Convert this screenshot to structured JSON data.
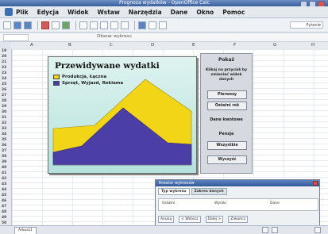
{
  "window": {
    "title": "Prognoza wydatków - OpenOffice Calc"
  },
  "menu": [
    "Plik",
    "Edycja",
    "Widok",
    "Wstaw",
    "Format",
    "Narzędzia",
    "Dane",
    "Okno",
    "Pomoc"
  ],
  "toolbar": {
    "help_text": "Pytanie"
  },
  "formula_bar": {
    "label": "Obszar wykresu"
  },
  "columns": [
    "A",
    "B",
    "C",
    "D",
    "E",
    "F",
    "G",
    "H"
  ],
  "rows": [
    "19",
    "20",
    "21",
    "22",
    "23",
    "24",
    "25",
    "26",
    "27",
    "28",
    "29",
    "30",
    "31",
    "32",
    "33",
    "34",
    "35",
    "36",
    "37",
    "38",
    "39",
    "40",
    "41",
    "42",
    "43",
    "44",
    "45",
    "46",
    "47",
    "48",
    "49",
    "50"
  ],
  "chart": {
    "title": "Przewidywane wydatki",
    "legend": [
      {
        "label": "Produkcja, Łączna",
        "color": "#f2d516"
      },
      {
        "label": "Sprzęt, Wyjazd, Reklama",
        "color": "#4b3ea6"
      }
    ],
    "colors": {
      "series_yellow": "#f2d516",
      "series_purple": "#4b3ea6"
    }
  },
  "panel": {
    "title": "Pokaż",
    "description": "Klikaj na przycisk by zmieniać widok danych",
    "buttons": [
      "Pierwszy",
      "Ostatni rok",
      "Wszystkie"
    ],
    "sections": [
      "Dane kwotowe",
      "Pensje"
    ],
    "footer": "Wyczyść"
  },
  "dialog": {
    "title": "Kreator wykresów",
    "tabs": [
      "Typ wykresu",
      "Zakres danych"
    ],
    "cells": [
      "Ostatni",
      "Wyniki",
      "Dane"
    ],
    "status": [
      "Anuluj",
      "< Wstecz",
      "Dalej >",
      "Zakończ"
    ]
  },
  "sheet_tabs": [
    "Arkusz1"
  ]
}
